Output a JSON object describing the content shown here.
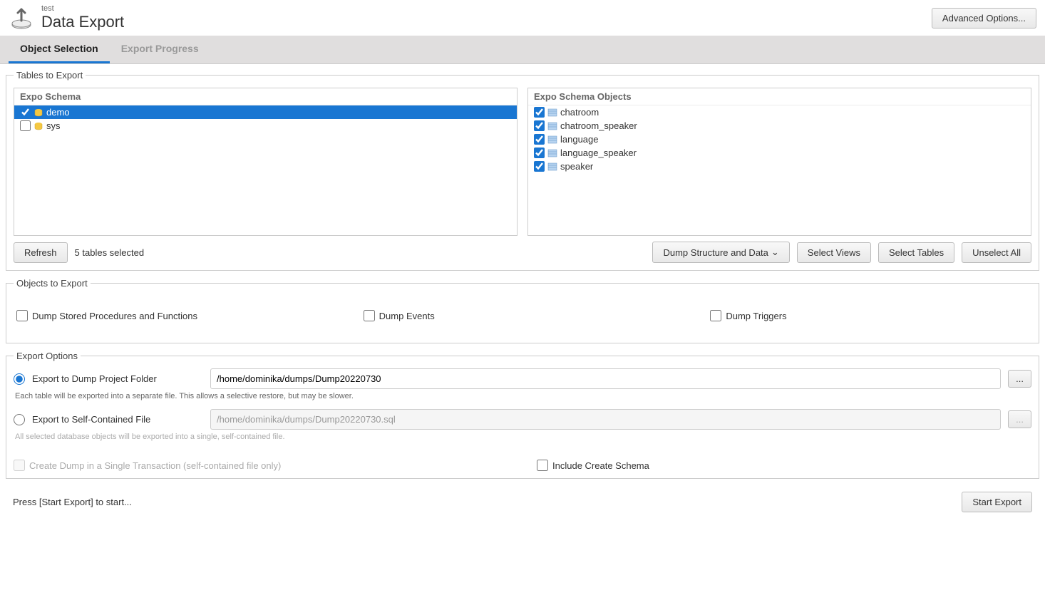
{
  "header": {
    "subtitle": "test",
    "title": "Data Export",
    "advanced_btn": "Advanced Options..."
  },
  "tabs": {
    "object_selection": "Object Selection",
    "export_progress": "Export Progress"
  },
  "tables_section": {
    "legend": "Tables to Export",
    "schema_header": "Expo Schema",
    "objects_header": "Expo Schema Objects",
    "schemas": [
      {
        "name": "demo",
        "checked": true,
        "selected": true
      },
      {
        "name": "sys",
        "checked": false,
        "selected": false
      }
    ],
    "objects": [
      {
        "name": "chatroom",
        "checked": true
      },
      {
        "name": "chatroom_speaker",
        "checked": true
      },
      {
        "name": "language",
        "checked": true
      },
      {
        "name": "language_speaker",
        "checked": true
      },
      {
        "name": "speaker",
        "checked": true
      }
    ],
    "refresh_btn": "Refresh",
    "selected_text": "5 tables selected",
    "dump_btn": "Dump Structure and Data",
    "select_views_btn": "Select Views",
    "select_tables_btn": "Select Tables",
    "unselect_all_btn": "Unselect All"
  },
  "objects_section": {
    "legend": "Objects to Export",
    "procedures": "Dump Stored Procedures and Functions",
    "events": "Dump Events",
    "triggers": "Dump Triggers"
  },
  "export_options": {
    "legend": "Export Options",
    "folder_label": "Export to Dump Project Folder",
    "folder_path": "/home/dominika/dumps/Dump20220730",
    "folder_hint": "Each table will be exported into a separate file. This allows a selective restore, but may be slower.",
    "file_label": "Export to Self-Contained File",
    "file_path": "/home/dominika/dumps/Dump20220730.sql",
    "file_hint": "All selected database objects will be exported into a single, self-contained file.",
    "browse_btn": "...",
    "single_transaction": "Create Dump in a Single Transaction (self-contained file only)",
    "include_schema": "Include Create Schema"
  },
  "footer": {
    "status": "Press [Start Export] to start...",
    "start_btn": "Start Export"
  }
}
